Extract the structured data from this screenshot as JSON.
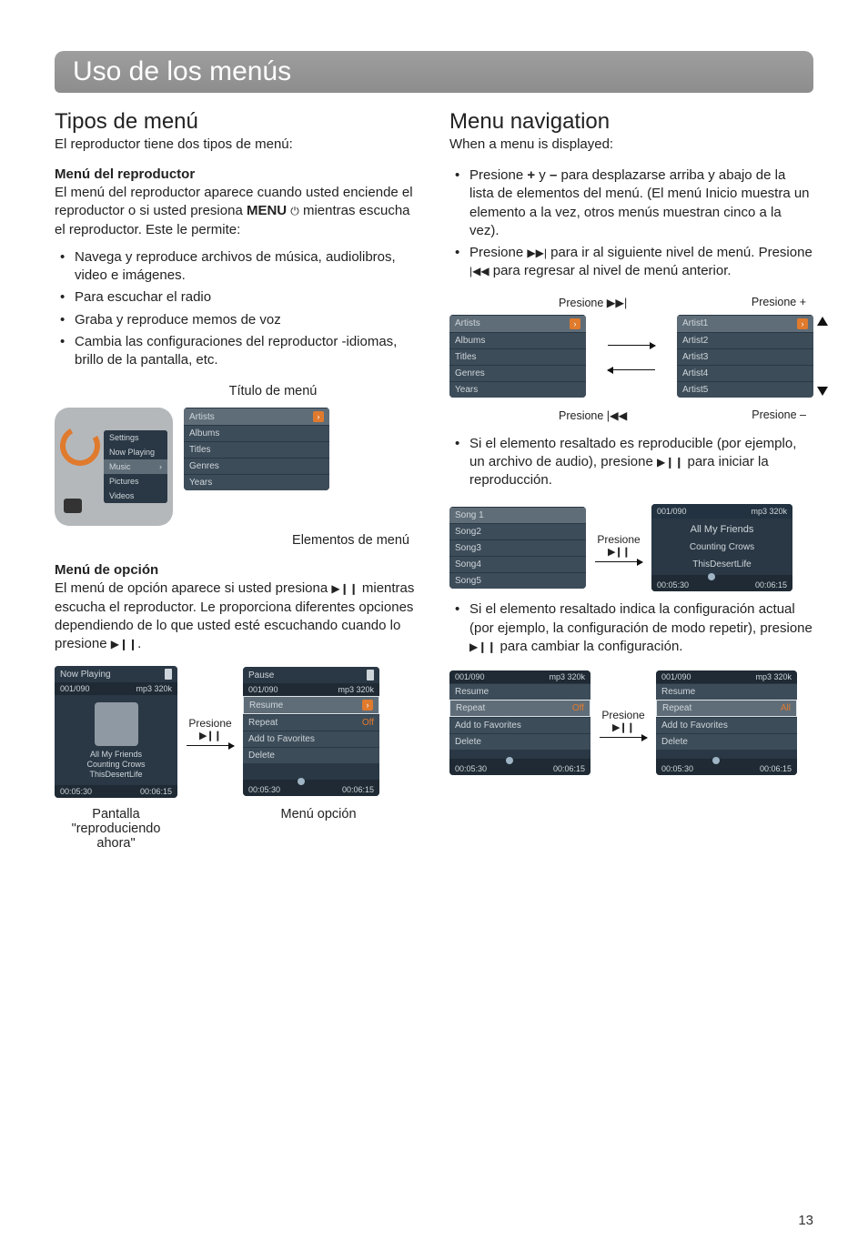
{
  "page_number": "13",
  "title": "Uso de los menús",
  "left": {
    "h2": "Tipos de menú",
    "lead": "El reproductor tiene dos tipos de menú:",
    "player_menu": {
      "heading": "Menú del reproductor",
      "p1_a": "El menú del reproductor aparece cuando usted enciende el reproductor o si usted presiona ",
      "p1_menu_word": "MENU",
      "p1_b": " mientras escucha el reproductor. Este le permite:",
      "bullets": [
        "Navega y reproduce archivos de música, audiolibros, video e imágenes.",
        "Para escuchar el radio",
        "Graba y reproduce memos de voz",
        "Cambia las configuraciones del reproductor -idiomas, brillo de la pantalla, etc."
      ]
    },
    "fig1": {
      "title_annot": "Título de menú",
      "items_annot": "Elementos de menú",
      "device_rows": [
        "Settings",
        "Now Playing",
        "Music",
        "Pictures",
        "Videos"
      ],
      "device_active": "Music",
      "list_rows": [
        "Artists",
        "Albums",
        "Titles",
        "Genres",
        "Years"
      ],
      "list_selected": "Artists"
    },
    "option_menu": {
      "heading": "Menú de opción",
      "p_a": "El menú de opción aparece si usted presiona ",
      "p_b": " mientras escucha el reproductor. Le proporciona diferentes opciones dependiendo de lo que usted esté escuchando cuando lo presione ",
      "p_c": "."
    },
    "fig2": {
      "np_header": "Now Playing",
      "counter": "001/090",
      "bitrate": "mp3 320k",
      "tracks": [
        "All My Friends",
        "Counting Crows",
        "ThisDesertLife"
      ],
      "t_elapsed": "00:05:30",
      "t_total": "00:06:15",
      "mid_label": "Presione",
      "pause_header": "Pause",
      "opt_rows": [
        {
          "label": "Resume",
          "sel": true
        },
        {
          "label": "Repeat",
          "val": "Off"
        },
        {
          "label": "Add to Favorites"
        },
        {
          "label": "Delete"
        }
      ],
      "np_caption_1": "Pantalla",
      "np_caption_2": "\"reproduciendo",
      "np_caption_3": "ahora\"",
      "opt_caption": "Menú opción"
    }
  },
  "right": {
    "h2": "Menu navigation",
    "lead": "When a menu is displayed:",
    "nav_bullets": {
      "b1_a": "Presione ",
      "b1_plus": "+",
      "b1_mid": " y ",
      "b1_minus": "–",
      "b1_b": " para desplazarse arriba y abajo de la lista de elementos del menú. (El menú Inicio muestra un elemento a la vez, otros menús muestran cinco a la vez).",
      "b2_a": "Presione ",
      "b2_b": " para ir al siguiente nivel de menú. Presione ",
      "b2_c": " para regresar al nivel de menú anterior."
    },
    "navfig": {
      "top_left": "Presione ▶▶|",
      "top_right": "Presione +",
      "bot_left": "Presione |◀◀",
      "bot_right": "Presione –",
      "left_list": [
        "Artists",
        "Albums",
        "Titles",
        "Genres",
        "Years"
      ],
      "left_sel": "Artists",
      "right_list": [
        "Artist1",
        "Artist2",
        "Artist3",
        "Artist4",
        "Artist5"
      ],
      "right_sel": "Artist1"
    },
    "b3_a": "Si el elemento resaltado es reproducible (por ejemplo, un archivo de audio), presione ",
    "b3_b": " para iniciar la reproducción.",
    "songfig": {
      "songs": [
        "Song 1",
        "Song2",
        "Song3",
        "Song4",
        "Song5"
      ],
      "sel": "Song 1",
      "mid_label": "Presione",
      "counter": "001/090",
      "bitrate": "mp3 320k",
      "line1": "All My Friends",
      "line2": "Counting Crows",
      "line3": "ThisDesertLife",
      "t_elapsed": "00:05:30",
      "t_total": "00:06:15"
    },
    "b4_a": "Si el elemento resaltado indica la configuración actual (por ejemplo, la configuración de modo repetir), presione ",
    "b4_b": " para cambiar la configuración.",
    "repfig": {
      "counter": "001/090",
      "bitrate": "mp3 320k",
      "mid_label": "Presione",
      "left_rows": [
        {
          "label": "Resume"
        },
        {
          "label": "Repeat",
          "val": "Off",
          "sel": true
        },
        {
          "label": "Add to Favorites"
        },
        {
          "label": "Delete"
        }
      ],
      "right_rows": [
        {
          "label": "Resume"
        },
        {
          "label": "Repeat",
          "val": "All",
          "sel": true
        },
        {
          "label": "Add to Favorites"
        },
        {
          "label": "Delete"
        }
      ],
      "t_elapsed": "00:05:30",
      "t_total": "00:06:15"
    }
  },
  "icons": {
    "power": "⏻",
    "playpause": "▶❙❙",
    "skipfwd": "▶▶|",
    "skipback": "|◀◀"
  }
}
